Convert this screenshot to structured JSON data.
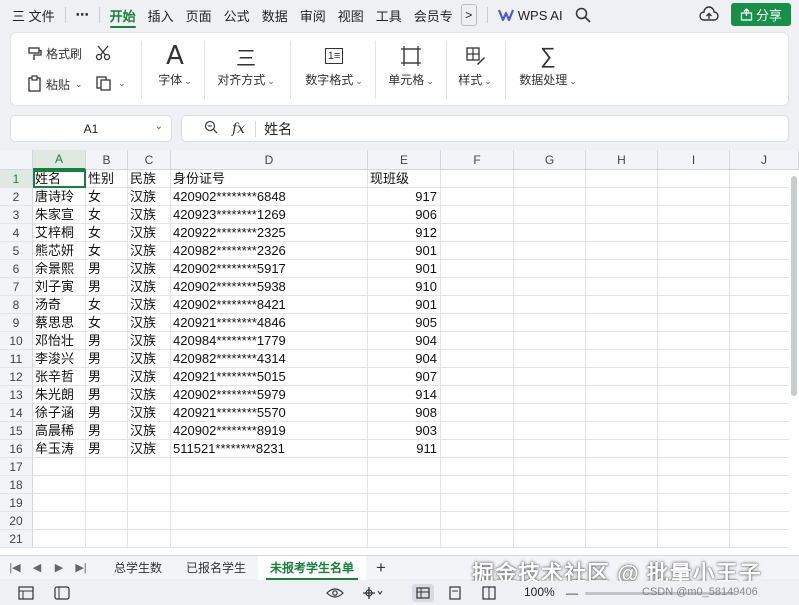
{
  "menubar": {
    "hamburger_label": "三 文件",
    "more_dots": "⋯",
    "tabs": [
      "开始",
      "插入",
      "页面",
      "公式",
      "数据",
      "审阅",
      "视图",
      "工具",
      "会员专"
    ],
    "active_tab": "开始",
    "more_chevron": ">",
    "wps_ai": "WPS AI",
    "share": "分享"
  },
  "ribbon": {
    "format_painter": "格式刷",
    "paste": "粘贴",
    "font": "字体",
    "align": "对齐方式",
    "number_format": "数字格式",
    "cell": "单元格",
    "style": "样式",
    "data_process": "数据处理",
    "font_icon_glyph": "A",
    "align_icon_glyph": "三",
    "number_icon_glyph": "1≡",
    "sigma_glyph": "∑"
  },
  "formula_bar": {
    "name_box": "A1",
    "fx": "fx",
    "value": "姓名"
  },
  "sheet": {
    "columns": [
      "A",
      "B",
      "C",
      "D",
      "E",
      "F",
      "G",
      "H",
      "I",
      "J"
    ],
    "row_numbers": [
      "1",
      "2",
      "3",
      "4",
      "5",
      "6",
      "7",
      "8",
      "9",
      "10",
      "11",
      "12",
      "13",
      "14",
      "15",
      "16",
      "17",
      "18",
      "19",
      "20",
      "21"
    ],
    "header_row": [
      "姓名",
      "性别",
      "民族",
      "身份证号",
      "现班级"
    ],
    "rows": [
      [
        "唐诗玲",
        "女",
        "汉族",
        "420902********6848",
        "917"
      ],
      [
        "朱家宣",
        "女",
        "汉族",
        "420923********1269",
        "906"
      ],
      [
        "艾梓桐",
        "女",
        "汉族",
        "420922********2325",
        "912"
      ],
      [
        "熊芯妍",
        "女",
        "汉族",
        "420982********2326",
        "901"
      ],
      [
        "余景熙",
        "男",
        "汉族",
        "420902********5917",
        "901"
      ],
      [
        "刘子寅",
        "男",
        "汉族",
        "420902********5938",
        "910"
      ],
      [
        " 汤奇",
        "女",
        "汉族",
        "420902********8421",
        "901"
      ],
      [
        "蔡思思",
        "女",
        "汉族",
        "420921********4846",
        "905"
      ],
      [
        "邓怡壮",
        "男",
        "汉族",
        "420984********1779",
        "904"
      ],
      [
        "李浚兴",
        "男",
        "汉族",
        "420982********4314",
        "904"
      ],
      [
        "张辛哲",
        "男",
        "汉族",
        "420921********5015",
        "907"
      ],
      [
        "朱光朗",
        "男",
        "汉族",
        "420902********5979",
        "914"
      ],
      [
        "徐子涵",
        "男",
        "汉族",
        "420921********5570",
        "908"
      ],
      [
        "高晨稀",
        "男",
        "汉族",
        "420902********8919",
        "903"
      ],
      [
        "牟玉涛",
        "男",
        "汉族",
        "511521********8231",
        "911"
      ]
    ]
  },
  "sheet_tabs": {
    "tabs": [
      "总学生数",
      "已报名学生",
      "未报考学生名单"
    ],
    "active": "未报考学生名单",
    "add": "+"
  },
  "status": {
    "zoom": "100%"
  },
  "overlay": {
    "watermark": "掘金技术社区 @ 批量小王子",
    "csdn": "CSDN @m0_58149406"
  },
  "colors": {
    "accent": "#1a7f3c",
    "share_bg": "#1a8f4a"
  }
}
